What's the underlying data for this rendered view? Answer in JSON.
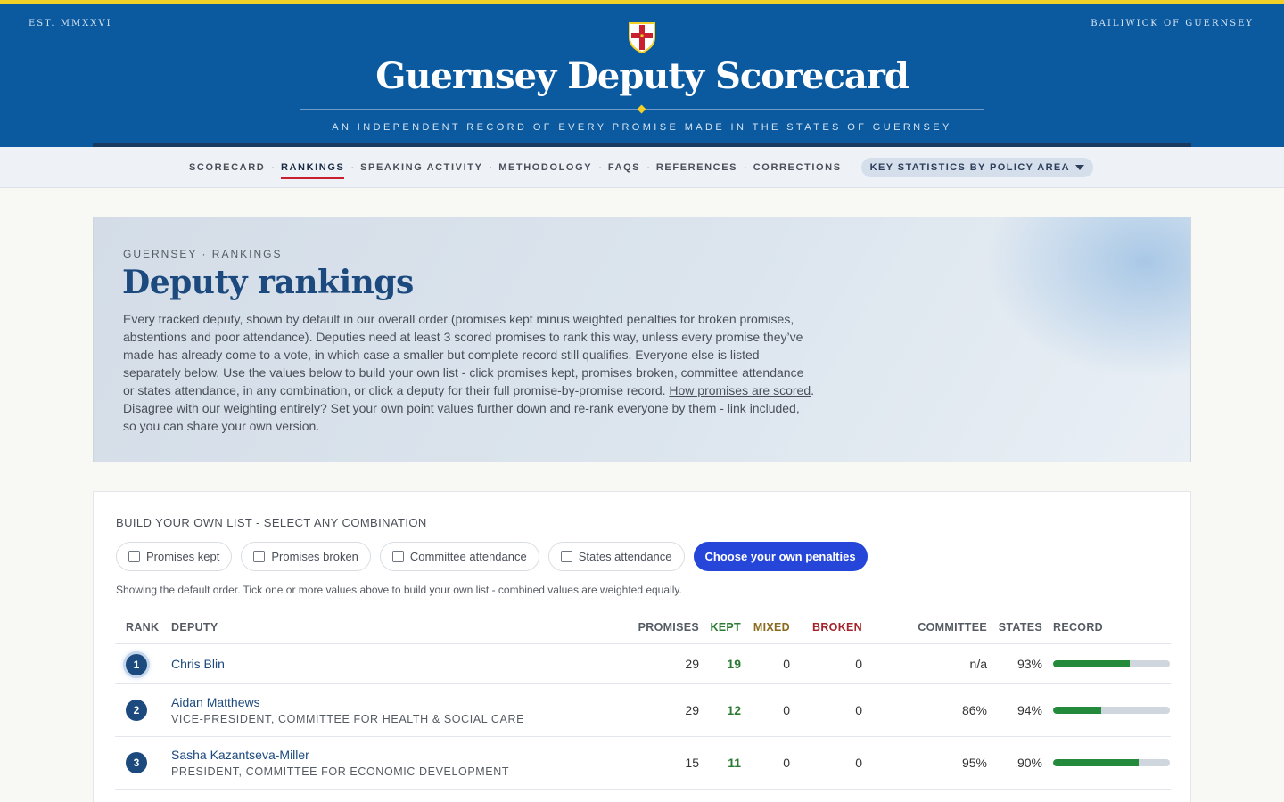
{
  "header": {
    "est": "EST. MMXXVI",
    "bailiwick": "BAILIWICK OF GUERNSEY",
    "title": "Guernsey Deputy Scorecard",
    "tagline": "AN INDEPENDENT RECORD OF EVERY PROMISE MADE IN THE STATES OF GUERNSEY",
    "crest_icon": "guernsey-cross-crest-icon"
  },
  "nav": {
    "items": [
      {
        "label": "SCORECARD",
        "active": false
      },
      {
        "label": "RANKINGS",
        "active": true
      },
      {
        "label": "SPEAKING ACTIVITY",
        "active": false
      },
      {
        "label": "METHODOLOGY",
        "active": false
      },
      {
        "label": "FAQS",
        "active": false
      },
      {
        "label": "REFERENCES",
        "active": false
      },
      {
        "label": "CORRECTIONS",
        "active": false
      }
    ],
    "separator": "·",
    "dropdown_label": "KEY STATISTICS BY POLICY AREA"
  },
  "hero": {
    "kicker": "GUERNSEY · RANKINGS",
    "title": "Deputy rankings",
    "body_before_link": "Every tracked deputy, shown by default in our overall order (promises kept minus weighted penalties for broken promises, abstentions and poor attendance). Deputies need at least 3 scored promises to rank this way, unless every promise they’ve made has already come to a vote, in which case a smaller but complete record still qualifies. Everyone else is listed separately below. Use the values below to build your own list - click promises kept, promises broken, committee attendance or states attendance, in any combination, or click a deputy for their full promise-by-promise record. ",
    "link_text": "How promises are scored",
    "body_after_link": ". Disagree with our weighting entirely? Set your own point values further down and re-rank everyone by them - link included, so you can share your own version."
  },
  "builder": {
    "label": "BUILD YOUR OWN LIST - SELECT ANY COMBINATION",
    "filters": [
      "Promises kept",
      "Promises broken",
      "Committee attendance",
      "States attendance"
    ],
    "primary_button": "Choose your own penalties",
    "helper": "Showing the default order. Tick one or more values above to build your own list - combined values are weighted equally."
  },
  "table": {
    "headers": {
      "rank": "RANK",
      "deputy": "DEPUTY",
      "promises": "PROMISES",
      "kept": "KEPT",
      "mixed": "MIXED",
      "broken": "BROKEN",
      "committee": "COMMITTEE",
      "states": "STATES",
      "record": "RECORD"
    },
    "rows": [
      {
        "rank": "1",
        "name": "Chris Blin",
        "role": "",
        "promises": "29",
        "kept": "19",
        "mixed": "0",
        "broken": "0",
        "committee": "n/a",
        "states": "93%",
        "record_fraction": 0.655
      },
      {
        "rank": "2",
        "name": "Aidan Matthews",
        "role": "VICE-PRESIDENT, COMMITTEE FOR HEALTH & SOCIAL CARE",
        "promises": "29",
        "kept": "12",
        "mixed": "0",
        "broken": "0",
        "committee": "86%",
        "states": "94%",
        "record_fraction": 0.414
      },
      {
        "rank": "3",
        "name": "Sasha Kazantseva-Miller",
        "role": "PRESIDENT, COMMITTEE FOR ECONOMIC DEVELOPMENT",
        "promises": "15",
        "kept": "11",
        "mixed": "0",
        "broken": "0",
        "committee": "95%",
        "states": "90%",
        "record_fraction": 0.733
      }
    ]
  },
  "colors": {
    "brand_blue": "#0b5aa0",
    "accent_yellow": "#f2d027",
    "kept_green": "#2a7a32",
    "mixed_amber": "#8a6a1c",
    "broken_red": "#a3242b",
    "button_blue": "#2546d8"
  }
}
